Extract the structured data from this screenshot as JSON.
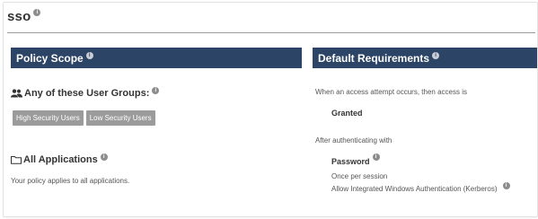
{
  "page": {
    "title": "sso"
  },
  "policy_scope": {
    "header": "Policy Scope",
    "user_groups_label": "Any of these User Groups:",
    "groups": [
      "High Security Users",
      "Low Security Users"
    ],
    "applications_label": "All Applications",
    "applications_note": "Your policy applies to all applications."
  },
  "default_requirements": {
    "header": "Default Requirements",
    "access_intro": "When an access attempt occurs, then access is",
    "access_value": "Granted",
    "auth_intro": "After authenticating with",
    "auth_method": "Password",
    "auth_frequency": "Once per session",
    "auth_option": "Allow Integrated Windows Authentication (Kerberos)"
  },
  "colors": {
    "header_bg": "#2c4465",
    "chip_bg": "#9b9b9b"
  }
}
